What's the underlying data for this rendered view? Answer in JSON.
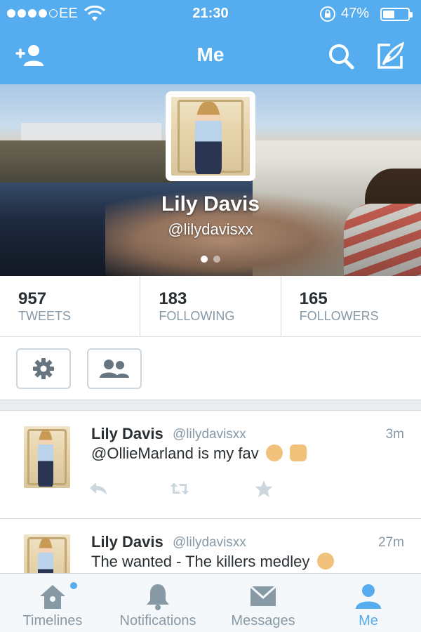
{
  "status_bar": {
    "signal_dots": 5,
    "signal_filled": 4,
    "carrier": "EE",
    "time": "21:30",
    "battery_percent": "47%",
    "battery_level": 0.47
  },
  "nav": {
    "title": "Me",
    "icons": [
      "add-user-icon",
      "search-icon",
      "compose-icon"
    ]
  },
  "profile": {
    "name": "Lily Davis",
    "handle": "@lilydavisxx",
    "page_count": 2,
    "current_page": 1
  },
  "stats": [
    {
      "value": "957",
      "label": "TWEETS"
    },
    {
      "value": "183",
      "label": "FOLLOWING"
    },
    {
      "value": "165",
      "label": "FOLLOWERS"
    }
  ],
  "action_buttons": [
    "gear-icon",
    "people-icon"
  ],
  "tweets": [
    {
      "name": "Lily Davis",
      "handle": "@lilydavisxx",
      "time": "3m",
      "text": "@OllieMarland is my fav",
      "emojis": [
        "ok-hand",
        "raised-hands"
      ]
    },
    {
      "name": "Lily Davis",
      "handle": "@lilydavisxx",
      "time": "27m",
      "text": "The wanted - The killers medley",
      "emojis": [
        "ok-hand"
      ]
    }
  ],
  "tabs": [
    {
      "label": "Timelines",
      "icon": "home-icon",
      "badge": true
    },
    {
      "label": "Notifications",
      "icon": "bell-icon",
      "badge": false
    },
    {
      "label": "Messages",
      "icon": "envelope-icon",
      "badge": false
    },
    {
      "label": "Me",
      "icon": "person-icon",
      "badge": false,
      "active": true
    }
  ],
  "colors": {
    "brand": "#55acee",
    "text_primary": "#292f33",
    "text_secondary": "#8899a6",
    "border": "#ccd6dd"
  }
}
